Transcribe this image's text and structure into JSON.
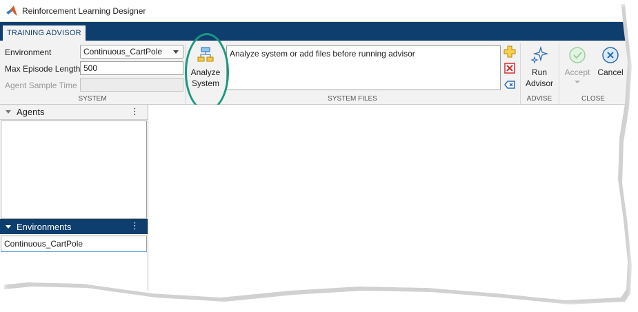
{
  "window": {
    "title": "Reinforcement Learning Designer"
  },
  "tabs": [
    {
      "label": "TRAINING ADVISOR",
      "active": true
    }
  ],
  "toolstrip": {
    "system": {
      "section_label": "SYSTEM",
      "environment_label": "Environment",
      "environment_value": "Continuous_CartPole",
      "max_episode_label": "Max Episode Length",
      "max_episode_value": "500",
      "agent_sample_label": "Agent Sample Time",
      "agent_sample_value": ""
    },
    "analyze_button": {
      "line1": "Analyze",
      "line2": "System"
    },
    "system_files": {
      "section_label": "SYSTEM FILES",
      "text": "Analyze system or add files before running advisor"
    },
    "advise": {
      "section_label": "ADVISE",
      "run_line1": "Run",
      "run_line2": "Advisor"
    },
    "close": {
      "section_label": "CLOSE",
      "accept_label": "Accept",
      "cancel_label": "Cancel"
    }
  },
  "left_panel": {
    "agents": {
      "title": "Agents",
      "items": []
    },
    "environments": {
      "title": "Environments",
      "items": [
        "Continuous_CartPole"
      ]
    },
    "kebab_glyph": "⋮"
  },
  "colors": {
    "accent": "#0e3e6e",
    "highlight": "#1a9a80",
    "toolstrip_bg": "#f2f2f2"
  },
  "icons": {
    "app_logo": "matlab-logo-icon",
    "analyze": "system-diagram-icon",
    "add_file": "plus-icon",
    "remove_file": "red-x-icon",
    "clear_files": "clear-icon",
    "run_advisor": "sparkle-icon",
    "accept": "check-circle-icon",
    "cancel": "x-circle-icon"
  }
}
